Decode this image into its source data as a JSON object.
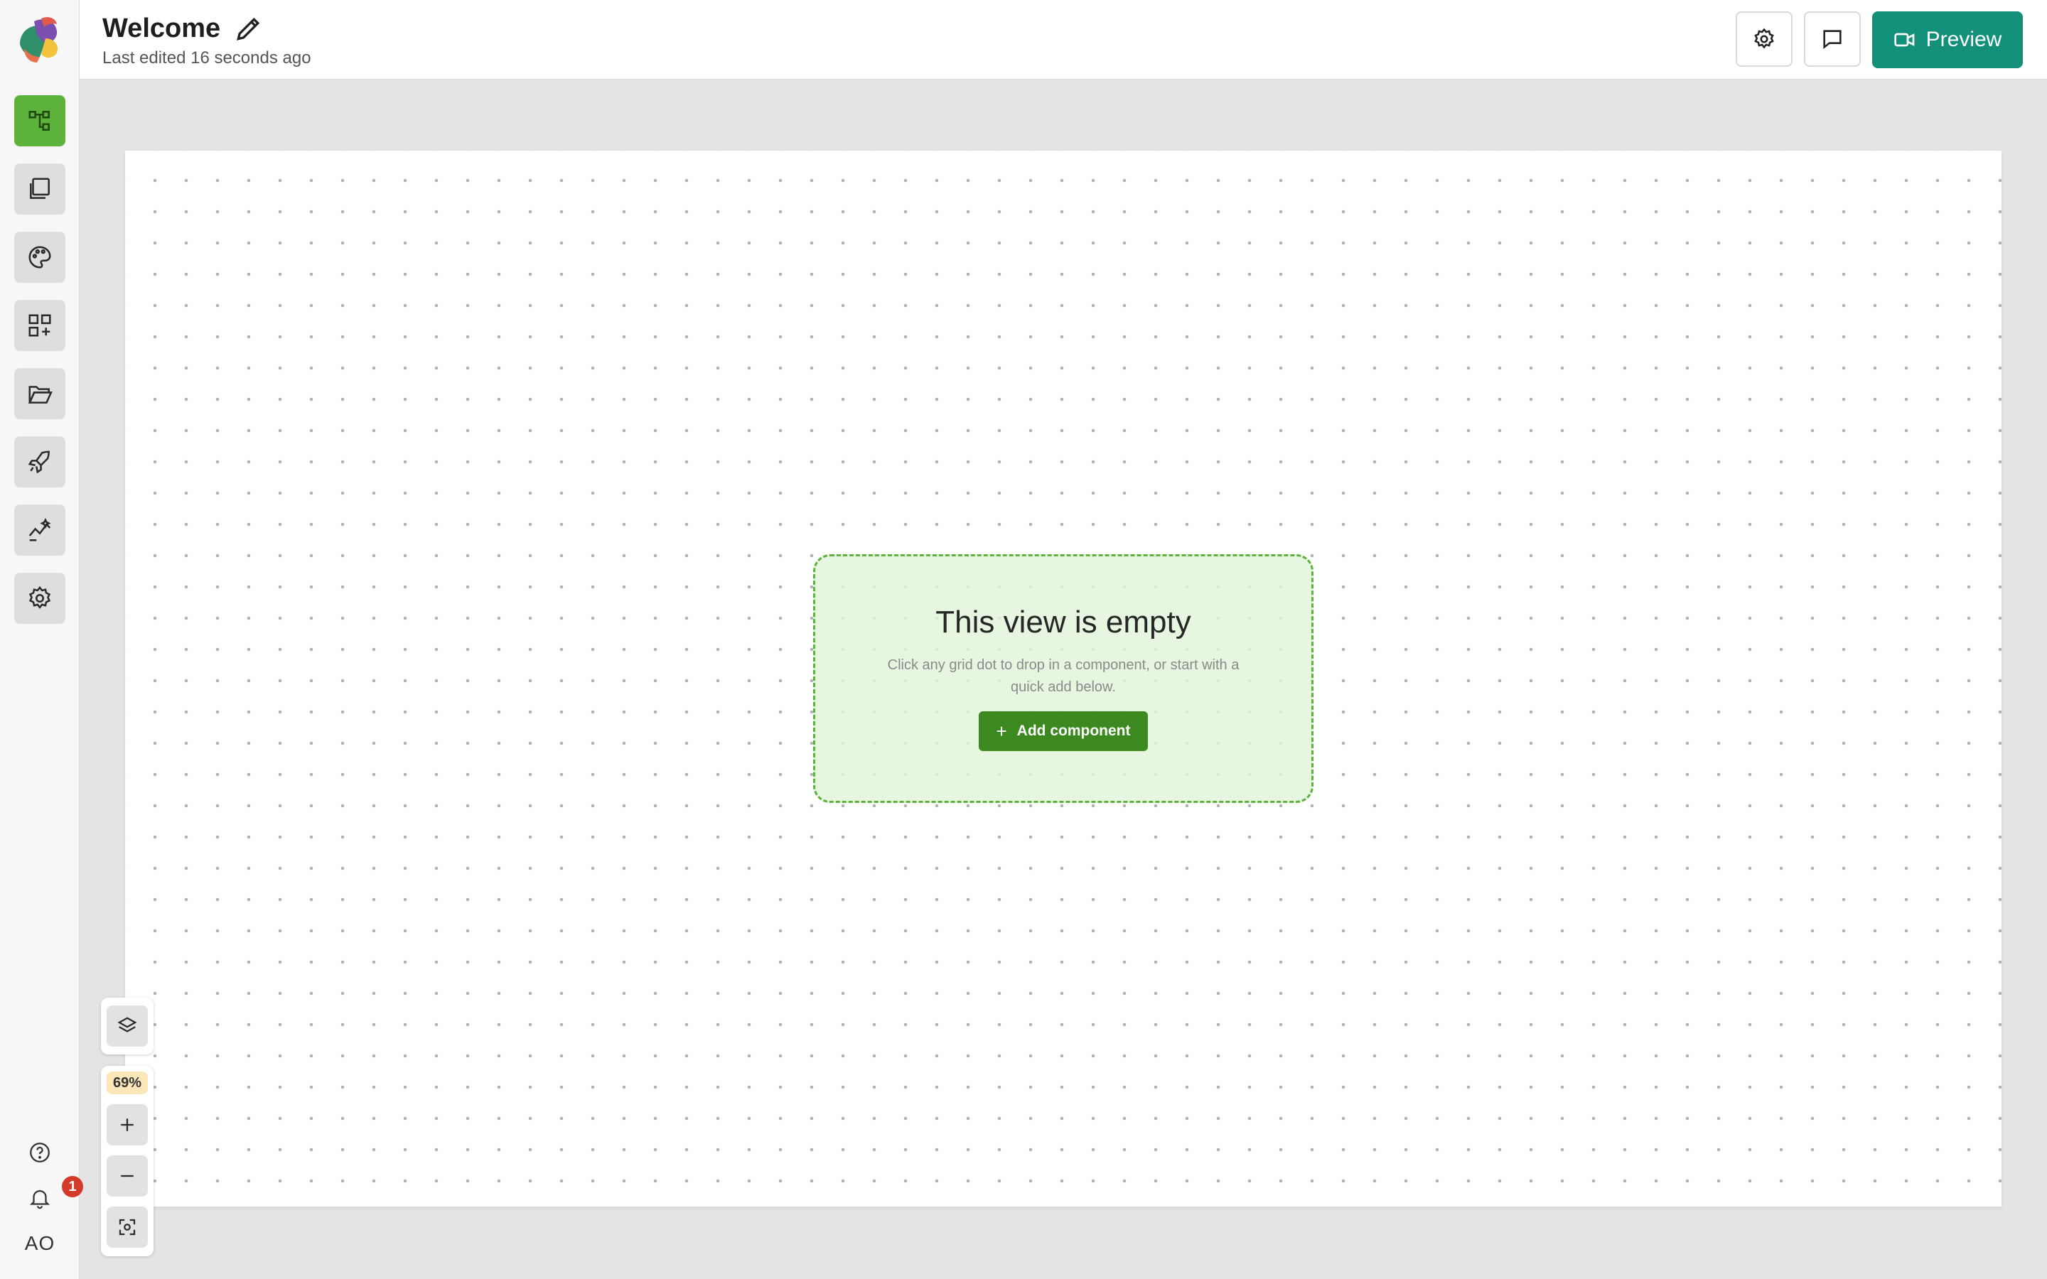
{
  "sidebar": {
    "items": [
      {
        "name": "diagram-icon",
        "active": true
      },
      {
        "name": "pages-icon",
        "active": false
      },
      {
        "name": "palette-icon",
        "active": false
      },
      {
        "name": "components-icon",
        "active": false
      },
      {
        "name": "folder-icon",
        "active": false
      },
      {
        "name": "rocket-icon",
        "active": false
      },
      {
        "name": "analytics-icon",
        "active": false
      },
      {
        "name": "settings-icon",
        "active": false
      }
    ],
    "notification_count": "1",
    "avatar_initials": "AO"
  },
  "header": {
    "title": "Welcome",
    "subtitle": "Last edited 16 seconds ago",
    "preview_label": "Preview"
  },
  "canvas": {
    "empty_title": "This view is empty",
    "empty_description": "Click any grid dot to drop in a component, or start with a quick add below.",
    "add_button_label": "Add component",
    "add_button_icon": "+"
  },
  "zoom": {
    "level": "69%"
  },
  "colors": {
    "accent_green": "#5cb23a",
    "add_button": "#3c8a1f",
    "preview_button": "#13907a",
    "badge_red": "#d43a2a"
  }
}
